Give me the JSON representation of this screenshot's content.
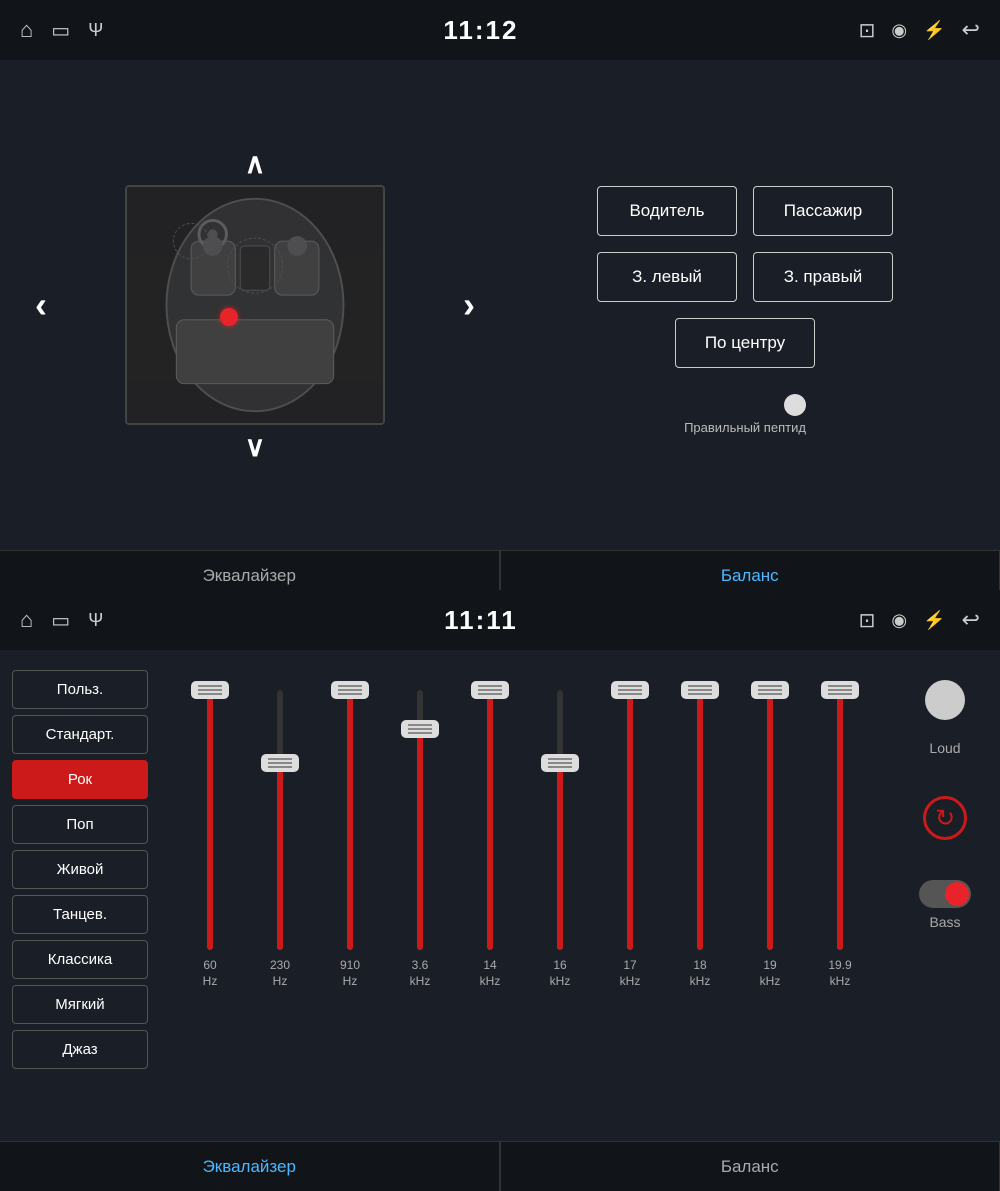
{
  "top_status_bar": {
    "time": "11:12"
  },
  "bottom_status_bar": {
    "time": "11:11"
  },
  "balance_section": {
    "title": "Баланс",
    "buttons": {
      "driver": "Водитель",
      "passenger": "Пассажир",
      "rear_left": "З. левый",
      "rear_right": "З. правый",
      "center": "По центру"
    },
    "radio_label": "Правильный пептид"
  },
  "tabs_top": {
    "equalizer": "Эквалайзер",
    "balance": "Баланс"
  },
  "tabs_bottom": {
    "equalizer": "Эквалайзер",
    "balance": "Баланс"
  },
  "equalizer": {
    "presets": [
      {
        "label": "Польз.",
        "active": false
      },
      {
        "label": "Стандарт.",
        "active": false
      },
      {
        "label": "Рок",
        "active": true
      },
      {
        "label": "Поп",
        "active": false
      },
      {
        "label": "Живой",
        "active": false
      },
      {
        "label": "Танцев.",
        "active": false
      },
      {
        "label": "Классика",
        "active": false
      },
      {
        "label": "Мягкий",
        "active": false
      },
      {
        "label": "Джаз",
        "active": false
      }
    ],
    "sliders": [
      {
        "freq": "60",
        "unit": "Hz",
        "fill_pct": 100,
        "thumb_pct": 100
      },
      {
        "freq": "230",
        "unit": "Hz",
        "fill_pct": 72,
        "thumb_pct": 72
      },
      {
        "freq": "910",
        "unit": "Hz",
        "fill_pct": 100,
        "thumb_pct": 100
      },
      {
        "freq": "3.6",
        "unit": "kHz",
        "fill_pct": 85,
        "thumb_pct": 85
      },
      {
        "freq": "14",
        "unit": "kHz",
        "fill_pct": 100,
        "thumb_pct": 100
      },
      {
        "freq": "16",
        "unit": "kHz",
        "fill_pct": 72,
        "thumb_pct": 72
      },
      {
        "freq": "17",
        "unit": "kHz",
        "fill_pct": 100,
        "thumb_pct": 100
      },
      {
        "freq": "18",
        "unit": "kHz",
        "fill_pct": 100,
        "thumb_pct": 100
      },
      {
        "freq": "19",
        "unit": "kHz",
        "fill_pct": 100,
        "thumb_pct": 100
      },
      {
        "freq": "19.9",
        "unit": "kHz",
        "fill_pct": 100,
        "thumb_pct": 100
      }
    ],
    "loud_label": "Loud",
    "bass_label": "Bass",
    "reset_label": "Reset"
  }
}
